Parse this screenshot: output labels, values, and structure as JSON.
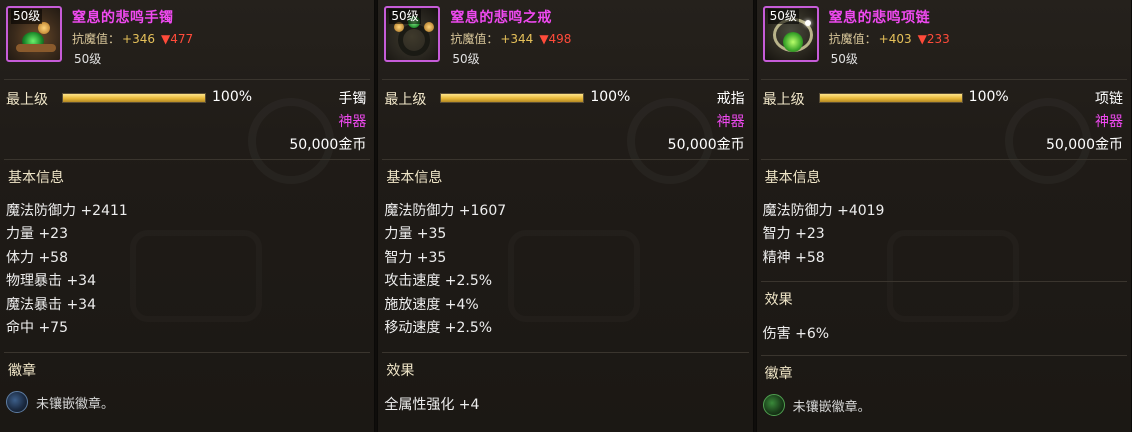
{
  "items": [
    {
      "level_tag": "50级",
      "name": "窒息的悲鸣手镯",
      "anti_magic_label": "抗魔值：",
      "anti_magic_up": "+346",
      "anti_magic_down": "▼477",
      "level": "50级",
      "grade_label": "最上级",
      "grade_percent": "100%",
      "grade_fill": 1.0,
      "type": "手镯",
      "rarity": "神器",
      "price": "50,000金币",
      "basic_info_title": "基本信息",
      "stats": [
        "魔法防御力 +2411",
        "力量 +23",
        "体力 +58",
        "物理暴击 +34",
        "魔法暴击 +34",
        "命中 +75"
      ],
      "badge_title": "徽章",
      "badge_text": "未镶嵌徽章。"
    },
    {
      "level_tag": "50级",
      "name": "窒息的悲鸣之戒",
      "anti_magic_label": "抗魔值：",
      "anti_magic_up": "+344",
      "anti_magic_down": "▼498",
      "level": "50级",
      "grade_label": "最上级",
      "grade_percent": "100%",
      "grade_fill": 1.0,
      "type": "戒指",
      "rarity": "神器",
      "price": "50,000金币",
      "basic_info_title": "基本信息",
      "stats": [
        "魔法防御力 +1607",
        "力量 +35",
        "智力 +35",
        "攻击速度 +2.5%",
        "施放速度 +4%",
        "移动速度 +2.5%"
      ],
      "effect_title": "效果",
      "effect_text": "全属性强化 +4"
    },
    {
      "level_tag": "50级",
      "name": "窒息的悲鸣项链",
      "anti_magic_label": "抗魔值：",
      "anti_magic_up": "+403",
      "anti_magic_down": "▼233",
      "level": "50级",
      "grade_label": "最上级",
      "grade_percent": "100%",
      "grade_fill": 1.0,
      "type": "项链",
      "rarity": "神器",
      "price": "50,000金币",
      "basic_info_title": "基本信息",
      "stats": [
        "魔法防御力 +4019",
        "智力 +23",
        "精神 +58"
      ],
      "effect_title": "效果",
      "effect_text": "伤害 +6%",
      "badge_title": "徽章",
      "badge_text": "未镶嵌徽章。"
    }
  ],
  "icons": [
    "bracelet-icon",
    "ring-icon",
    "necklace-icon",
    "badge-slot-icon"
  ],
  "colors": {
    "name": "#ef49f0",
    "rarity": "#ef49f0",
    "anti_up": "#e6c15a",
    "anti_down": "#ff4b3a",
    "section_title": "#f0e6c8",
    "background": "#1f1b17"
  }
}
